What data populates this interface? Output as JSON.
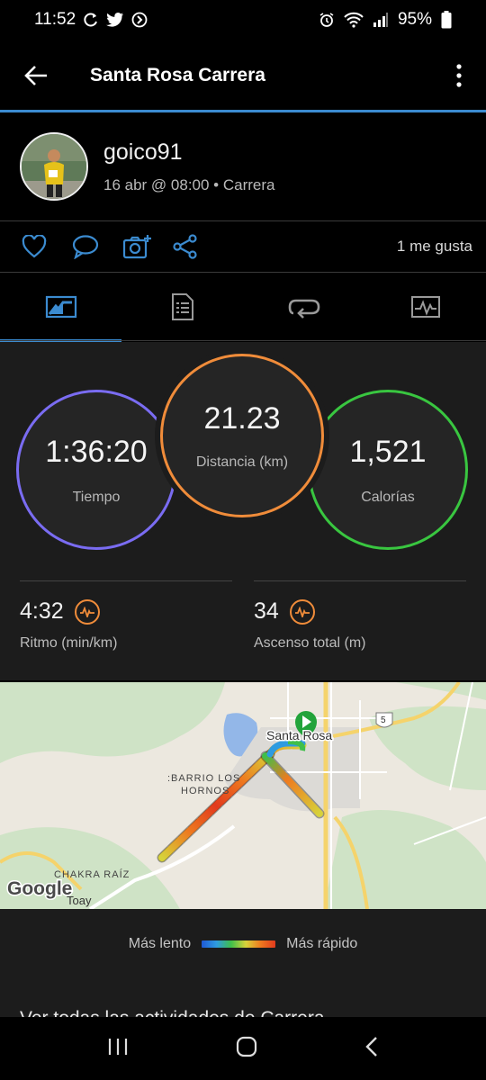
{
  "status": {
    "time": "11:52",
    "battery": "95%"
  },
  "appbar": {
    "title": "Santa Rosa Carrera"
  },
  "profile": {
    "username": "goico91",
    "meta": "16 abr @ 08:00 • Carrera"
  },
  "actions": {
    "likes": "1 me gusta"
  },
  "tabs": [
    {
      "name": "overview",
      "active": true
    },
    {
      "name": "details"
    },
    {
      "name": "laps"
    },
    {
      "name": "charts"
    }
  ],
  "stats": {
    "time": {
      "value": "1:36:20",
      "label": "Tiempo"
    },
    "distance": {
      "value": "21.23",
      "label": "Distancia (km)"
    },
    "calories": {
      "value": "1,521",
      "label": "Calorías"
    },
    "pace": {
      "value": "4:32",
      "label": "Ritmo (min/km)"
    },
    "ascent": {
      "value": "34",
      "label": "Ascenso total (m)"
    }
  },
  "map": {
    "labels": {
      "town": "Santa Rosa",
      "barrio_line1": ":BARRIO LOS",
      "barrio_line2": "HORNOS",
      "chakra": "CHAKRA RAÍZ",
      "toay": "Toay",
      "route_num": "5",
      "google": "Google"
    }
  },
  "legend": {
    "slow": "Más lento",
    "fast": "Más rápido"
  },
  "footer": {
    "link": "Ver todas las actividades de Carrera"
  },
  "colors": {
    "accent": "#3b8bd0",
    "time_ring": "#7a6cf2",
    "distance_ring": "#f08c3a",
    "calories_ring": "#39c640"
  }
}
